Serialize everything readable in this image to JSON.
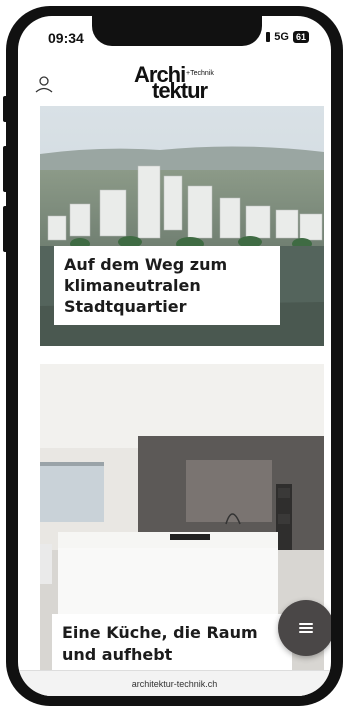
{
  "status_bar": {
    "time": "09:34",
    "network": "5G",
    "battery": "61"
  },
  "header": {
    "logo_line1": "Archi",
    "logo_line2": "tektur",
    "logo_suffix": "+Technik",
    "user_icon": "user-icon"
  },
  "articles": [
    {
      "title": "Auf dem Weg zum klimaneutralen Stadtquartier"
    },
    {
      "title": "Eine Küche, die Raum und aufhebt"
    }
  ],
  "menu_button": {
    "icon": "hamburger-menu-icon"
  },
  "browser": {
    "url": "architektur-technik.ch"
  },
  "colors": {
    "fab": "#4a4747",
    "caption_bg": "#ffffff",
    "text": "#1c1c1c"
  }
}
